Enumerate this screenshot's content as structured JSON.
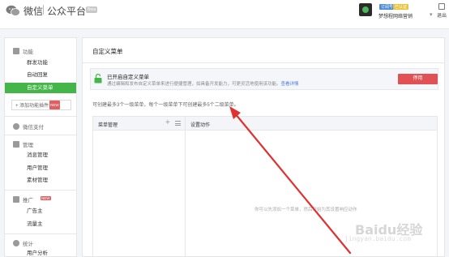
{
  "header": {
    "brand": "微信",
    "platform": "公众平台",
    "beta": "Beta",
    "avatar_icon": "avatar-icon",
    "badge_subscription": "订阅号",
    "badge_verified": "已认证",
    "account_name": "梦想程网络营销",
    "exit_label": "退出"
  },
  "sidebar": {
    "function_title": "功能",
    "function_items": [
      "群发功能",
      "自动回复",
      "自定义菜单"
    ],
    "active_item": "自定义菜单",
    "add_plugin": "+ 添加功能插件",
    "new_badge": "NEW",
    "pay_title": "微信支付",
    "manage_title": "管理",
    "manage_items": [
      "消息管理",
      "用户管理",
      "素材管理"
    ],
    "promo_title": "推广",
    "promo_items": [
      "广告主",
      "流量主"
    ],
    "stats_title": "统计",
    "stats_items": [
      "用户分析"
    ]
  },
  "main": {
    "title": "自定义菜单",
    "notice_title": "已开启自定义菜单",
    "notice_desc": "通过编辑和发布自定义菜单来进行便捷管理，如具备开发能力，可更灵活地使用该功能。",
    "notice_link": "查看详情",
    "stop_button": "停用",
    "hint": "可创建最多3个一级菜单，每个一级菜单下可创建最多5个二级菜单。",
    "menu_manage_label": "菜单管理",
    "action_label": "设置动作",
    "empty_tip": "你可以先添加一个菜单，然后开始为其设置响应动作"
  },
  "watermark": {
    "text": "Baidu经验",
    "sub": "jingyan.baidu.com"
  },
  "colors": {
    "accent_green": "#44b549",
    "danger_red": "#e15054",
    "arrow_red": "#e03030",
    "link_blue": "#4a7bd1"
  }
}
